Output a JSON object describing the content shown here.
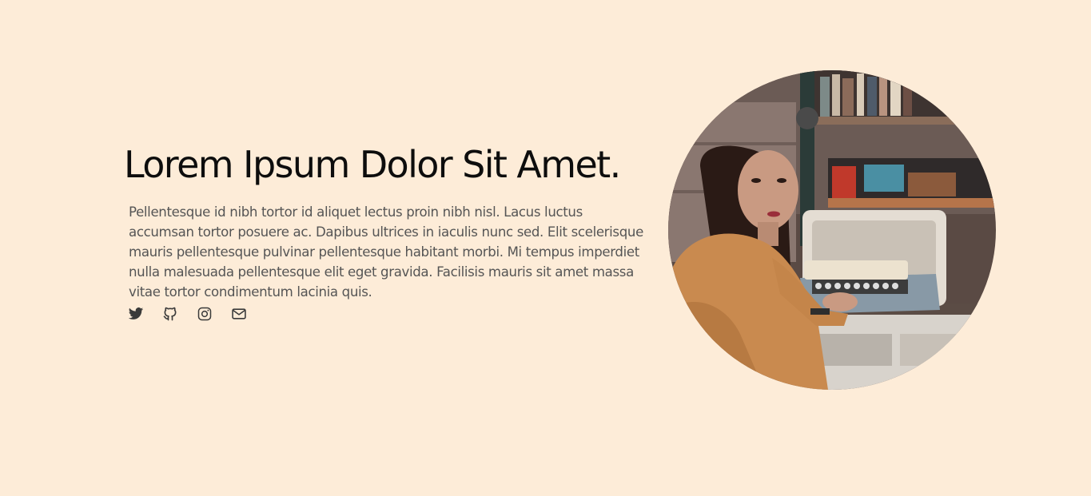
{
  "hero": {
    "title": "Lorem Ipsum Dolor Sit Amet.",
    "description": "Pellentesque id nibh tortor id aliquet lectus proin nibh nisl. Lacus luctus accumsan tortor posuere ac. Dapibus ultrices in iaculis nunc sed. Elit scelerisque mauris pellentesque pulvinar pellentesque habitant morbi. Mi tempus imperdiet nulla malesuada pellentesque elit eget gravida. Facilisis mauris sit amet massa vitae tortor condimentum lacinia quis.",
    "social_icons": [
      "twitter-icon",
      "github-icon",
      "instagram-icon",
      "mail-icon"
    ],
    "portrait_image": "woman-at-typewriter-photo"
  },
  "colors": {
    "background": "#fdecd8",
    "heading": "#0d0d0d",
    "body_text": "#555555",
    "icon": "#3a3a3a"
  }
}
